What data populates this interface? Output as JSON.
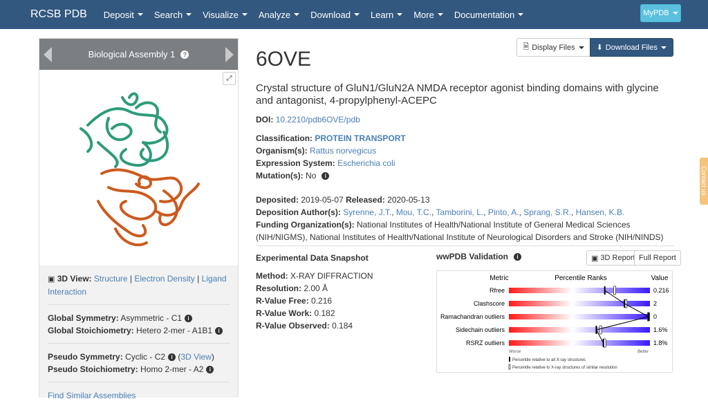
{
  "nav": {
    "brand": "RCSB PDB",
    "items": [
      "Deposit",
      "Search",
      "Visualize",
      "Analyze",
      "Download",
      "Learn",
      "More",
      "Documentation"
    ],
    "mypdb": "MyPDB"
  },
  "assembly": {
    "title": "Biological Assembly 1",
    "view_label": "3D View:",
    "view_links": [
      "Structure",
      "Electron Density",
      "Ligand Interaction"
    ],
    "global_symmetry_label": "Global Symmetry:",
    "global_symmetry": "Asymmetric - C1",
    "global_stoich_label": "Global Stoichiometry:",
    "global_stoich": "Hetero 2-mer - A1B1",
    "pseudo_symmetry_label": "Pseudo Symmetry:",
    "pseudo_symmetry": "Cyclic - C2",
    "pseudo_3d_link": "3D View",
    "pseudo_stoich_label": "Pseudo Stoichiometry:",
    "pseudo_stoich": "Homo 2-mer - A2",
    "find_similar": "Find Similar Assemblies"
  },
  "entry": {
    "id": "6OVE",
    "title": "Crystal structure of GluN1/GluN2A NMDA receptor agonist binding domains with glycine and antagonist, 4-propylphenyl-ACEPC",
    "display_files": "Display Files",
    "download_files": "Download Files",
    "doi_label": "DOI:",
    "doi": "10.2210/pdb6OVE/pdb",
    "classification_label": "Classification:",
    "classification": "PROTEIN TRANSPORT",
    "organism_label": "Organism(s):",
    "organism": "Rattus norvegicus",
    "expression_label": "Expression System:",
    "expression": "Escherichia coli",
    "mutation_label": "Mutation(s):",
    "mutation": "No",
    "deposited_label": "Deposited:",
    "deposited": "2019-05-07",
    "released_label": "Released:",
    "released": "2020-05-13",
    "authors_label": "Deposition Author(s):",
    "authors": [
      "Syrenne, J.T.",
      "Mou, T.C.",
      "Tamborini, L.",
      "Pinto, A.",
      "Sprang, S.R.",
      "Hansen, K.B."
    ],
    "funding_label": "Funding Organization(s):",
    "funding": "National Institutes of Health/National Institute of General Medical Sciences (NIH/NIGMS), National Institutes of Health/National Institute of Neurological Disorders and Stroke (NIH/NINDS)"
  },
  "experimental": {
    "title": "Experimental Data Snapshot",
    "method_label": "Method:",
    "method": "X-RAY DIFFRACTION",
    "resolution_label": "Resolution:",
    "resolution": "2.00 Å",
    "rfree_label": "R-Value Free:",
    "rfree": "0.216",
    "rwork_label": "R-Value Work:",
    "rwork": "0.182",
    "robs_label": "R-Value Observed:",
    "robs": "0.184"
  },
  "validation": {
    "title": "wwPDB Validation",
    "report_3d": "3D Report",
    "report_full": "Full Report",
    "col_metric": "Metric",
    "col_percentile": "Percentile Ranks",
    "col_value": "Value",
    "metrics": [
      {
        "name": "Rfree",
        "value": "0.216",
        "pct_all": 0.68,
        "pct_sim": 0.75
      },
      {
        "name": "Clashscore",
        "value": "2",
        "pct_all": 0.82,
        "pct_sim": 0.83
      },
      {
        "name": "Ramachandran outliers",
        "value": "0",
        "pct_all": 0.99,
        "pct_sim": 0.99
      },
      {
        "name": "Sidechain outliers",
        "value": "1.6%",
        "pct_all": 0.62,
        "pct_sim": 0.65
      },
      {
        "name": "RSRZ outliers",
        "value": "1.8%",
        "pct_all": 0.67,
        "pct_sim": 0.68
      }
    ],
    "worse": "Worse",
    "better": "Better",
    "legend_all": "Percentile relative to all X-ray structures",
    "legend_similar": "Percentile relative to X-ray structures of similar resolution"
  },
  "feedback": "Contact us",
  "colors": {
    "navbar": "#325880",
    "link": "#4a7fb5",
    "chain_a": "#2e9b7b",
    "chain_b": "#cc5a1e"
  }
}
